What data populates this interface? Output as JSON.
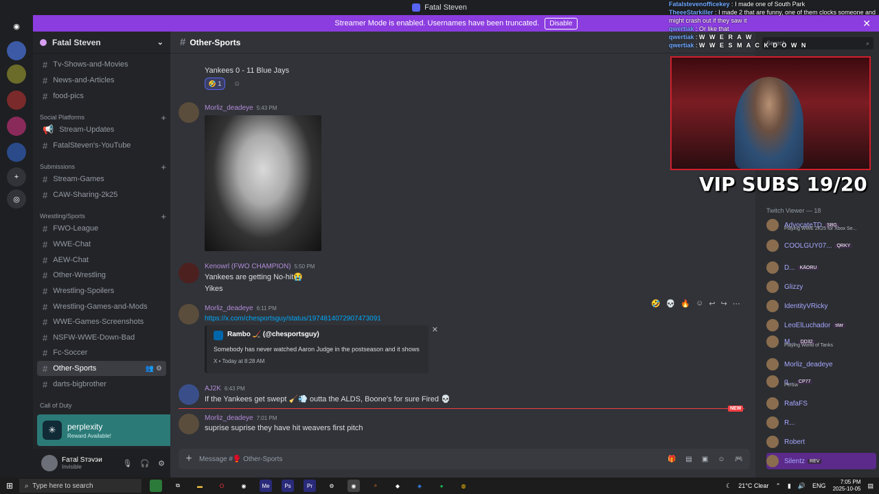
{
  "window": {
    "title": "Fatal Steven"
  },
  "banner": {
    "text": "Streamer Mode is enabled. Usernames have been truncated.",
    "disable_label": "Disable"
  },
  "guild": {
    "name": "Fatal Steven"
  },
  "channels": [
    {
      "label": "Tv-Shows-and-Movies",
      "icon": "tv-icon"
    },
    {
      "label": "News-and-Articles",
      "icon": "news-icon"
    },
    {
      "label": "food-pics",
      "icon": "food-icon"
    },
    {
      "category": "Social Platforms"
    },
    {
      "label": "Stream-Updates",
      "icon": "megaphone-icon"
    },
    {
      "label": "FatalSteven's-YouTube",
      "icon": ""
    },
    {
      "category": "Submissions"
    },
    {
      "label": "Stream-Games",
      "icon": "controller-icon"
    },
    {
      "label": "CAW-Sharing-2k25",
      "icon": "flex-icon"
    },
    {
      "category": "Wrestling/Sports"
    },
    {
      "label": "FWO-League",
      "icon": ""
    },
    {
      "label": "WWE-Chat",
      "icon": "chat-icon"
    },
    {
      "label": "AEW-Chat",
      "icon": "chat-icon"
    },
    {
      "label": "Other-Wrestling",
      "icon": "chat-icon"
    },
    {
      "label": "Wrestling-Spoilers",
      "icon": "chat-icon"
    },
    {
      "label": "Wrestling-Games-and-Mods",
      "icon": "chat-icon"
    },
    {
      "label": "WWE-Games-Screenshots",
      "icon": "chat-icon"
    },
    {
      "label": "NSFW-WWE-Down-Bad",
      "icon": "nsfw-icon"
    },
    {
      "label": "Fc-Soccer",
      "icon": "soccer-icon"
    },
    {
      "label": "Other-Sports",
      "icon": "glove-icon",
      "active": true
    },
    {
      "label": "darts-bigbrother",
      "icon": "dart-icon"
    },
    {
      "category": "Call of Duty"
    }
  ],
  "perplexity": {
    "title": "perplexity",
    "subtitle": "Reward Available!"
  },
  "user": {
    "name": "Faтal Sтэvэи",
    "status": "Invisible"
  },
  "channel_header": {
    "name": "Other-Sports"
  },
  "messages": {
    "m0": {
      "text": "Yankees 0 - 11 Blue Jays",
      "reaction_count": "1"
    },
    "m1": {
      "author": "Morliz_deadeye",
      "time": "5:43 PM"
    },
    "m2": {
      "author": "Kenowrl (FWO CHAMPION)",
      "time": "5:50 PM",
      "line1": "Yankees are getting No-hit😭",
      "line2": "Yikes"
    },
    "m3": {
      "author": "Morliz_deadeye",
      "time": "6:11 PM",
      "link": "https://x.com/chesportsguy/status/1974814072907473091",
      "embed_author": "Rambo 🏒 (@chesportsguy)",
      "embed_desc": "Somebody has never watched Aaron Judge in the postseason and it shows",
      "embed_footer": "X • Today at 8:28 AM"
    },
    "m4": {
      "author": "AJ2K",
      "time": "6:43 PM",
      "text": "If the Yankees get swept 🧹💨 outta the ALDS, Boone's for sure Fired 💀"
    },
    "new_label": "NEW",
    "m5": {
      "author": "Morliz_deadeye",
      "time": "7:01 PM",
      "text": "suprise suprise they have hit weavers first pitch"
    }
  },
  "composer": {
    "placeholder": "Message #🥊 Other-Sports"
  },
  "search": {
    "placeholder": "Search"
  },
  "stream_overlay": {
    "chat": [
      {
        "name": "Fatalstevenofficekey",
        "text": "I made one of South Park"
      },
      {
        "name": "TheeeStarkiller",
        "text": "I made 2 that are funny, one of them clocks someone and might crash out if they saw it"
      },
      {
        "name": "qwertiak",
        "text": "Or like that"
      },
      {
        "name": "qwertiak",
        "text": "W W E R A W"
      },
      {
        "name": "qwertiak",
        "text": "W W E S M A C K D O W N"
      }
    ],
    "vip": "VIP SUBS 19/20"
  },
  "members": {
    "header": "Twitch Viewer — 18",
    "list": [
      {
        "name": "AdvocateTD",
        "tag": "SBG",
        "activity": "Playing WWE 2K25 for Xbox Se..."
      },
      {
        "name": "COOLGUY07...",
        "tag": "QRKY",
        "activity": ""
      },
      {
        "name": "D...",
        "tag": "KÄORU",
        "activity": ""
      },
      {
        "name": "Glizzy",
        "tag": "",
        "activity": ""
      },
      {
        "name": "IdentityVRicky",
        "tag": "",
        "activity": ""
      },
      {
        "name": "LeoElLuchador",
        "tag": "star",
        "activity": ""
      },
      {
        "name": "M...",
        "tag": "DD32",
        "activity": "Playing World of Tanks"
      },
      {
        "name": "Morliz_deadeye",
        "tag": "",
        "activity": ""
      },
      {
        "name": "q...",
        "tag": "CP77",
        "activity": "Persia"
      },
      {
        "name": "RafaFS",
        "tag": "",
        "activity": ""
      },
      {
        "name": "R...",
        "tag": "",
        "activity": ""
      },
      {
        "name": "Robert",
        "tag": "",
        "activity": ""
      },
      {
        "name": "Silentz",
        "tag": "REV",
        "activity": ""
      }
    ]
  },
  "taskbar": {
    "search": "Type here to search",
    "weather": "21°C  Clear",
    "lang": "ENG",
    "time": "7:05 PM",
    "date": "2025-10-05"
  }
}
